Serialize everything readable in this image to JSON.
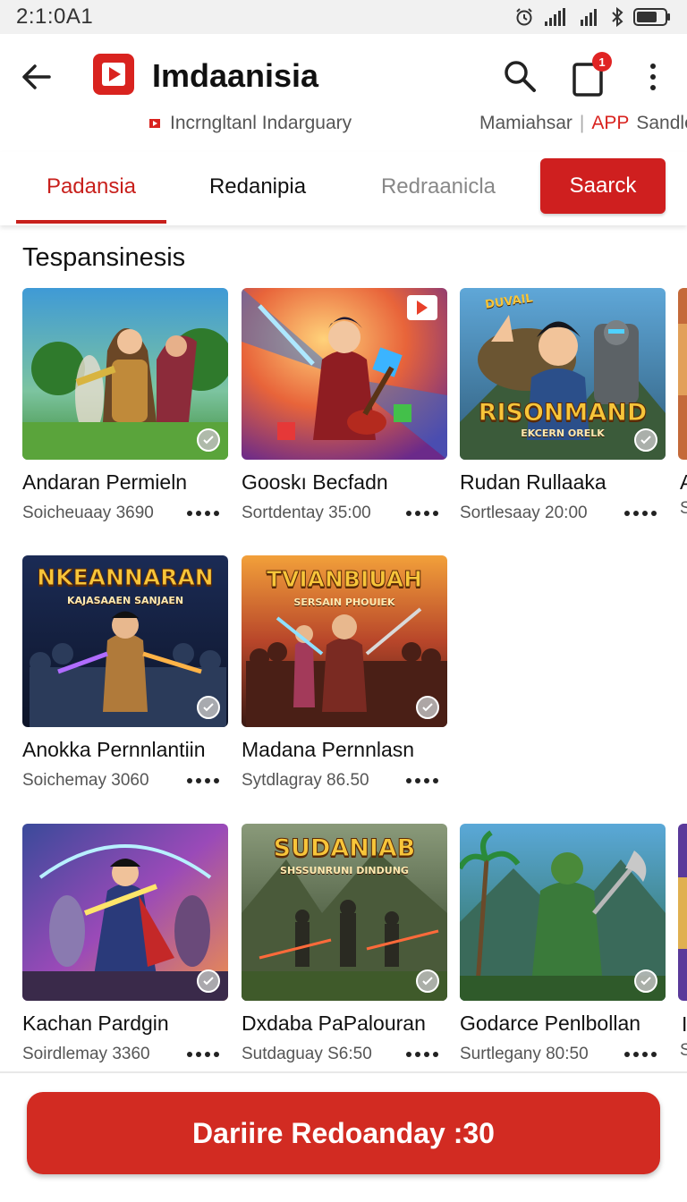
{
  "status_bar": {
    "time": "2:1:0A1"
  },
  "app_bar": {
    "title": "Imdaanisia",
    "notification_count": "1"
  },
  "sub_header": {
    "left_text": "Incrngltanl Indarguary",
    "right_text": "Mamiahsar",
    "separator": "|",
    "app_label": "APP",
    "sandbox_label": "Sandled"
  },
  "tabs": [
    {
      "label": "Padansia",
      "active": true
    },
    {
      "label": "Redanipia",
      "active": false
    },
    {
      "label": "Redraanicla",
      "active": false
    }
  ],
  "search_button": {
    "label": "Saarck"
  },
  "section": {
    "title": "Tespansinesis"
  },
  "videos": [
    {
      "title": "Andaran Permieln",
      "meta": "Soicheuaay 3690"
    },
    {
      "title": "Gooskı Becfadn",
      "meta": "Sortdentay 35:00"
    },
    {
      "title": "Rudan Rullaaka",
      "meta": "Sortlesaay 20:00",
      "thumb_text": "RISONMAND",
      "thumb_sub": "EKCERN ORELK",
      "thumb_top": "DUVAIL"
    },
    {
      "title": "Anokka Pernnlantiin",
      "meta": "Soichemay 3060",
      "thumb_text": "NKEANNARAN",
      "thumb_sub": "KAJASAAEN SANJAEN"
    },
    {
      "title": "Madana Pernnlasn",
      "meta": "Sytdlagray 86.50",
      "thumb_text": "TVIANBIUAH",
      "thumb_sub": "SERSAIN PHOUIEK"
    },
    {
      "title": "Kachan Pardgin",
      "meta": "Soirdlemay 3360"
    },
    {
      "title": "Dxdaba PaPalouran",
      "meta": "Sutdaguay S6:50",
      "thumb_text": "SUDANIAB",
      "thumb_sub": "SHSSUNRUNI DINDUNG"
    },
    {
      "title": "Godarce Penlbollan",
      "meta": "Surtlegany 80:50"
    }
  ],
  "edge_cards": [
    {
      "title": "A",
      "meta": "S"
    },
    {
      "title": "I",
      "meta": "S"
    }
  ],
  "bottom_button": {
    "label": "Dariire Redoanday :30"
  },
  "colors": {
    "brand_red": "#d9231f",
    "button_red": "#d22b22",
    "tab_active": "#c8201c"
  },
  "icons": [
    "back-arrow-icon",
    "play-logo-icon",
    "search-icon",
    "notification-square-icon",
    "more-vert-icon",
    "alarm-icon",
    "signal-icon",
    "bluetooth-icon",
    "battery-icon",
    "check-circle-icon"
  ]
}
